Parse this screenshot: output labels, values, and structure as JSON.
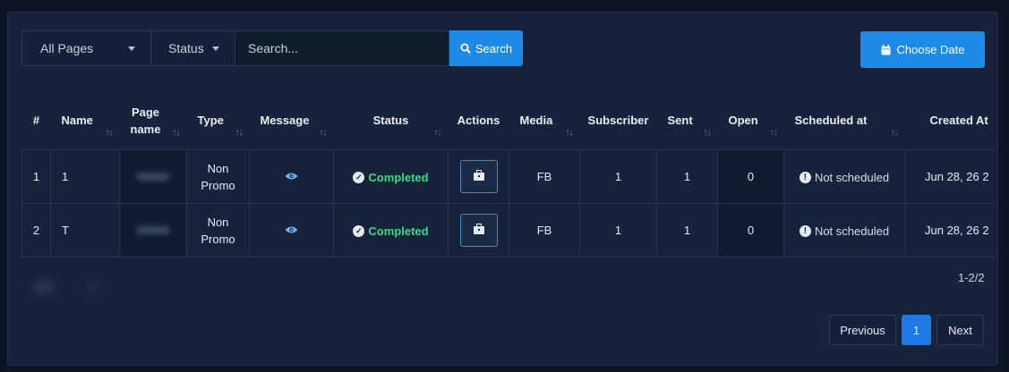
{
  "filters": {
    "pages_select": "All Pages",
    "status_select": "Status",
    "search_placeholder": "Search...",
    "search_button": "Search",
    "date_button": "Choose Date"
  },
  "table": {
    "headers": [
      "#",
      "Name",
      "Page name",
      "Type",
      "Message",
      "Status",
      "Actions",
      "Media",
      "Subscriber",
      "Sent",
      "Open",
      "Scheduled at",
      "Created At"
    ],
    "rows": [
      {
        "num": "1",
        "name": "1",
        "type": "Non Promo",
        "status": "Completed",
        "media": "FB",
        "subscriber": "1",
        "sent": "1",
        "open": "0",
        "scheduled": "Not scheduled",
        "created": "Jun 28, 26 2"
      },
      {
        "num": "2",
        "name": "T",
        "type": "Non Promo",
        "status": "Completed",
        "media": "FB",
        "subscriber": "1",
        "sent": "1",
        "open": "0",
        "scheduled": "Not scheduled",
        "created": "Jun 28, 26 2"
      }
    ]
  },
  "pagination": {
    "count": "1-2/2",
    "previous": "Previous",
    "current": "1",
    "next": "Next"
  }
}
